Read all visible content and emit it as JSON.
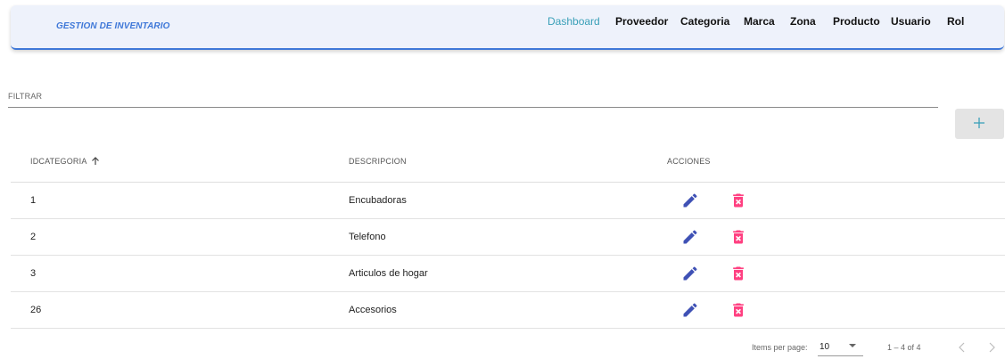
{
  "navbar": {
    "brand": "GESTION DE INVENTARIO",
    "links": [
      "Dashboard",
      "Proveedor",
      "Categoria",
      "Marca",
      "Zona",
      "Producto",
      "Usuario",
      "Rol"
    ]
  },
  "filter": {
    "label": "FILTRAR"
  },
  "add_button": {
    "icon": "plus-icon"
  },
  "table": {
    "columns": [
      "IDCATEGORIA",
      "DESCRIPCION",
      "ACCIONES"
    ],
    "sort_indicator": "arrow-up-icon",
    "rows": [
      {
        "id": "1",
        "descripcion": "Encubadoras"
      },
      {
        "id": "2",
        "descripcion": "Telefono"
      },
      {
        "id": "3",
        "descripcion": "Articulos de hogar"
      },
      {
        "id": "26",
        "descripcion": "Accesorios"
      }
    ],
    "action_icons": [
      "edit-pencil-icon",
      "delete-trash-icon"
    ]
  },
  "paginator": {
    "items_per_page_label": "Items per page:",
    "items_per_page_value": "10",
    "range_label": "1 – 4 of 4"
  },
  "colors": {
    "brand": "#3f78d8",
    "active_link": "#3aa0b8",
    "edit": "#3f51b5",
    "delete": "#ff4081"
  }
}
